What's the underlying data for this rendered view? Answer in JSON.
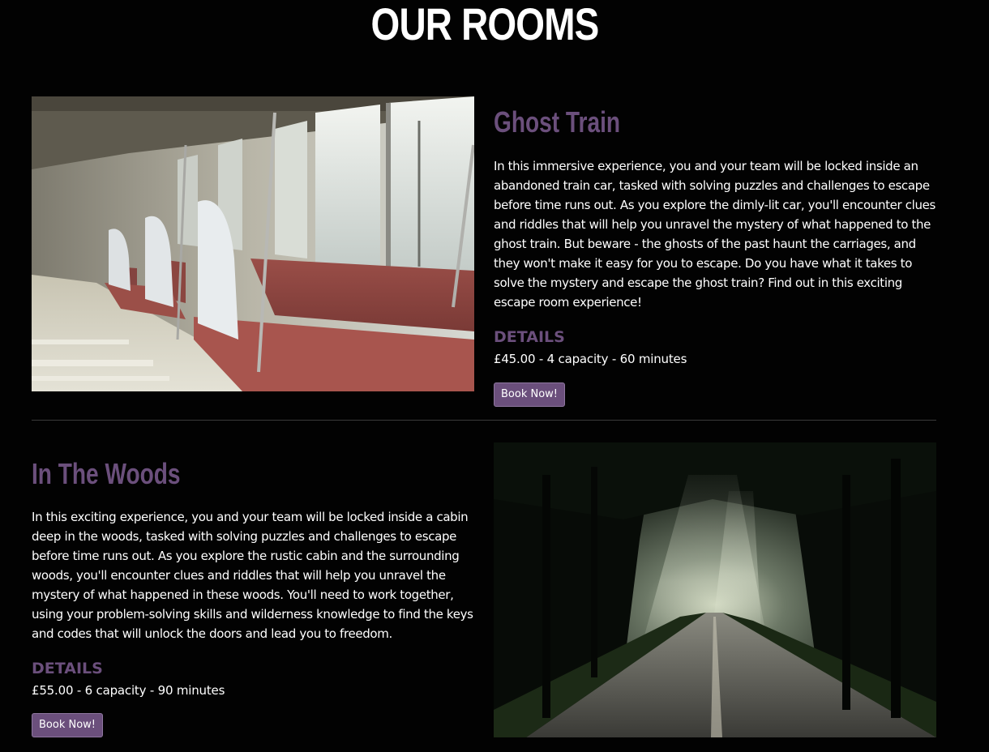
{
  "page": {
    "title": "OUR ROOMS"
  },
  "rooms": [
    {
      "name": "Ghost Train",
      "image_alt": "Empty train carriage with red bench seats",
      "description": "In this immersive experience, you and your team will be locked inside an abandoned train car, tasked with solving puzzles and challenges to escape before time runs out. As you explore the dimly-lit car, you'll encounter clues and riddles that will help you unravel the mystery of what happened to the ghost train. But beware - the ghosts of the past haunt the carriages, and they won't make it easy for you to escape. Do you have what it takes to solve the mystery and escape the ghost train? Find out in this exciting escape room experience!",
      "details_heading": "DETAILS",
      "details": "£45.00 - 4 capacity - 60 minutes",
      "button_label": "Book Now!"
    },
    {
      "name": "In The Woods",
      "image_alt": "Road through a dark forest with light rays",
      "description": "In this exciting experience, you and your team will be locked inside a cabin deep in the woods, tasked with solving puzzles and challenges to escape before time runs out. As you explore the rustic cabin and the surrounding woods, you'll encounter clues and riddles that will help you unravel the mystery of what happened in these woods. You'll need to work together, using your problem-solving skills and wilderness knowledge to find the keys and codes that will unlock the doors and lead you to freedom.",
      "details_heading": "DETAILS",
      "details": "£55.00 - 6 capacity - 90 minutes",
      "button_label": "Book Now!"
    }
  ],
  "colors": {
    "background": "#020202",
    "accent": "#6b4f7c",
    "text": "#ffffff"
  }
}
